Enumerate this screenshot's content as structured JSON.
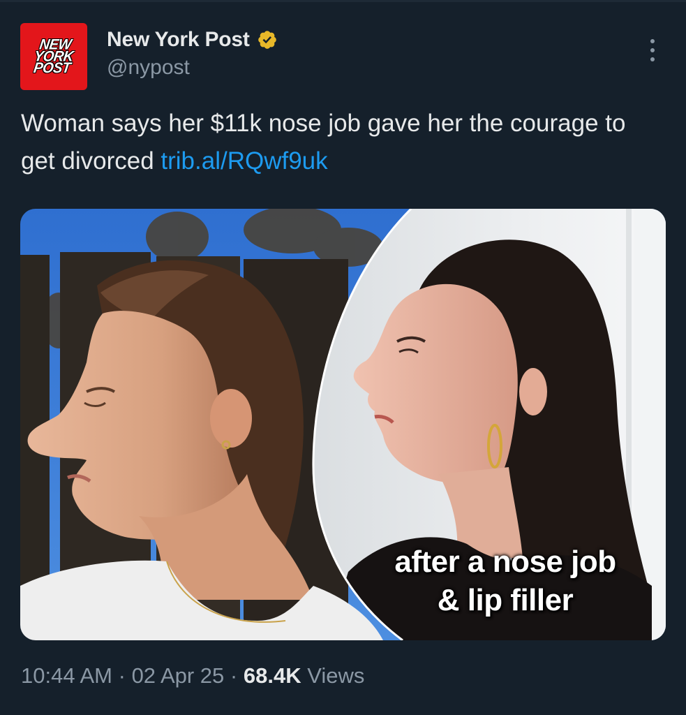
{
  "account": {
    "avatar_lines": [
      "NEW",
      "YORK",
      "POST"
    ],
    "display_name": "New York Post",
    "handle": "@nypost",
    "verified_icon": "verified-gold-badge-icon"
  },
  "tweet": {
    "text": "Woman says her $11k nose job gave her the courage to get divorced ",
    "link": "trib.al/RQwf9uk"
  },
  "media": {
    "caption_lines": [
      "after a nose job",
      "& lip filler"
    ]
  },
  "meta": {
    "time": "10:44 AM",
    "separator": "·",
    "date": "02 Apr 25",
    "views_count": "68.4K",
    "views_label": "Views"
  },
  "colors": {
    "background": "#15202b",
    "text_primary": "#e7e9ea",
    "text_secondary": "#8b98a5",
    "link": "#1d9bf0",
    "brand_red": "#e3161b",
    "verified_gold": "#e8b829"
  }
}
